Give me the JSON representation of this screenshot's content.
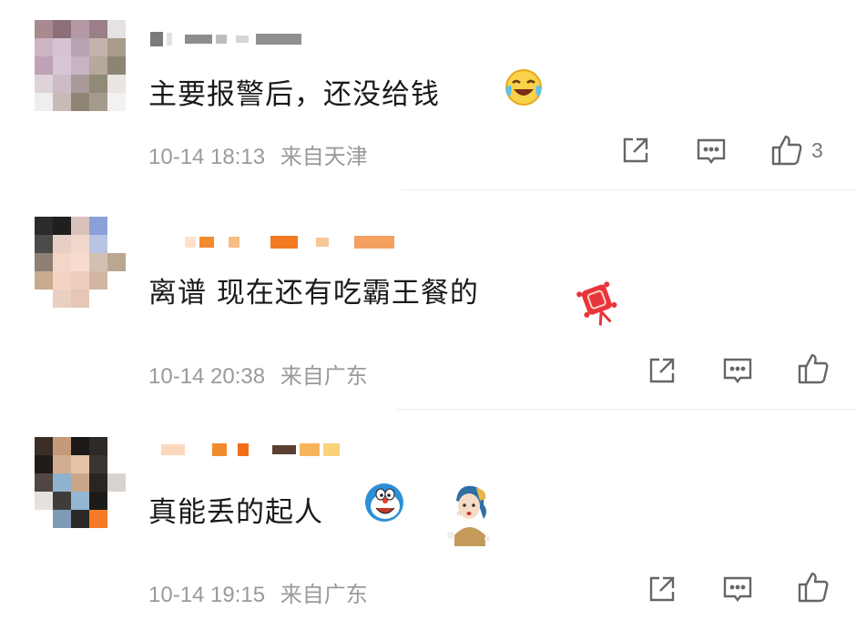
{
  "comments": [
    {
      "text": "主要报警后，还没给钱",
      "time": "10-14 18:13",
      "location": "来自天津",
      "like_count": "3",
      "emoji": "laugh-cry-emoji"
    },
    {
      "text": "离谱 现在还有吃霸王餐的",
      "time": "10-14 20:38",
      "location": "来自广东",
      "like_count": "",
      "emoji": "red-lucky-knot-emoji"
    },
    {
      "text": "真能丢的起人",
      "time": "10-14 19:15",
      "location": "来自广东",
      "like_count": "",
      "emoji": "doraemon-emoji"
    }
  ],
  "icons": {
    "share": "share-icon",
    "reply": "comment-icon",
    "like": "thumbs-up-icon"
  },
  "colors": {
    "text": "#1a1a1a",
    "meta": "#9a9a9a",
    "icon": "#666666",
    "divider": "#ececec"
  }
}
